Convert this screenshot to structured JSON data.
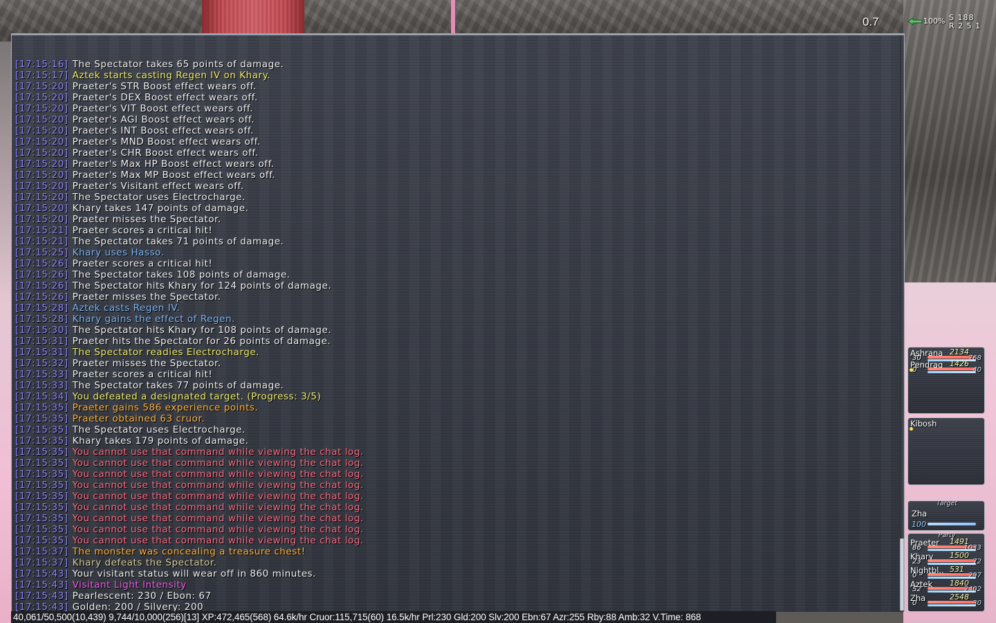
{
  "hud": {
    "fps": "0.7",
    "compass_pct": "100%",
    "compass_s": "S 188",
    "compass_r": "R 2 5 1"
  },
  "chat": {
    "lines": [
      {
        "ts": "[17:15:16]",
        "msg": "The Spectator takes 65 points of damage.",
        "color": "white"
      },
      {
        "ts": "[17:15:17]",
        "msg": "Aztek starts casting Regen IV on Khary.",
        "color": "yellow"
      },
      {
        "ts": "[17:15:20]",
        "msg": "Praeter's STR Boost effect wears off.",
        "color": "white"
      },
      {
        "ts": "[17:15:20]",
        "msg": "Praeter's DEX Boost effect wears off.",
        "color": "white"
      },
      {
        "ts": "[17:15:20]",
        "msg": "Praeter's VIT Boost effect wears off.",
        "color": "white"
      },
      {
        "ts": "[17:15:20]",
        "msg": "Praeter's AGI Boost effect wears off.",
        "color": "white"
      },
      {
        "ts": "[17:15:20]",
        "msg": "Praeter's INT Boost effect wears off.",
        "color": "white"
      },
      {
        "ts": "[17:15:20]",
        "msg": "Praeter's MND Boost effect wears off.",
        "color": "white"
      },
      {
        "ts": "[17:15:20]",
        "msg": "Praeter's CHR Boost effect wears off.",
        "color": "white"
      },
      {
        "ts": "[17:15:20]",
        "msg": "Praeter's Max HP Boost effect wears off.",
        "color": "white"
      },
      {
        "ts": "[17:15:20]",
        "msg": "Praeter's Max MP Boost effect wears off.",
        "color": "white"
      },
      {
        "ts": "[17:15:20]",
        "msg": "Praeter's Visitant effect wears off.",
        "color": "white"
      },
      {
        "ts": "[17:15:20]",
        "msg": "The Spectator uses Electrocharge.",
        "color": "white"
      },
      {
        "ts": "[17:15:20]",
        "msg": "Khary takes 147 points of damage.",
        "color": "white"
      },
      {
        "ts": "[17:15:20]",
        "msg": "Praeter misses the Spectator.",
        "color": "white"
      },
      {
        "ts": "[17:15:21]",
        "msg": "Praeter scores a critical hit!",
        "color": "white"
      },
      {
        "ts": "[17:15:21]",
        "msg": "The Spectator takes 71 points of damage.",
        "color": "white"
      },
      {
        "ts": "[17:15:25]",
        "msg": "Khary uses Hasso.",
        "color": "blue"
      },
      {
        "ts": "[17:15:26]",
        "msg": "Praeter scores a critical hit!",
        "color": "white"
      },
      {
        "ts": "[17:15:26]",
        "msg": "The Spectator takes 108 points of damage.",
        "color": "white"
      },
      {
        "ts": "[17:15:26]",
        "msg": "The Spectator hits Khary for 124 points of damage.",
        "color": "white"
      },
      {
        "ts": "[17:15:26]",
        "msg": "Praeter misses the Spectator.",
        "color": "white"
      },
      {
        "ts": "[17:15:28]",
        "msg": "Aztek casts Regen IV.",
        "color": "blue"
      },
      {
        "ts": "[17:15:28]",
        "msg": "Khary gains the effect of Regen.",
        "color": "blue"
      },
      {
        "ts": "[17:15:30]",
        "msg": "The Spectator hits Khary for 108 points of damage.",
        "color": "white"
      },
      {
        "ts": "[17:15:31]",
        "msg": "Praeter hits the Spectator for 26 points of damage.",
        "color": "white"
      },
      {
        "ts": "[17:15:31]",
        "msg": "The Spectator readies Electrocharge.",
        "color": "yellow"
      },
      {
        "ts": "[17:15:32]",
        "msg": "Praeter misses the Spectator.",
        "color": "white"
      },
      {
        "ts": "[17:15:33]",
        "msg": "Praeter scores a critical hit!",
        "color": "white"
      },
      {
        "ts": "[17:15:33]",
        "msg": "The Spectator takes 77 points of damage.",
        "color": "white"
      },
      {
        "ts": "[17:15:34]",
        "msg": "You defeated a designated target. (Progress: 3/5)",
        "color": "yellow"
      },
      {
        "ts": "[17:15:35]",
        "msg": "Praeter gains 586 experience points.",
        "color": "orange"
      },
      {
        "ts": "[17:15:35]",
        "msg": "Praeter obtained 63 cruor.",
        "color": "orange"
      },
      {
        "ts": "[17:15:35]",
        "msg": "The Spectator uses Electrocharge.",
        "color": "white"
      },
      {
        "ts": "[17:15:35]",
        "msg": "Khary takes 179 points of damage.",
        "color": "white"
      },
      {
        "ts": "[17:15:35]",
        "msg": "You cannot use that command while viewing the chat log.",
        "color": "red"
      },
      {
        "ts": "[17:15:35]",
        "msg": "You cannot use that command while viewing the chat log.",
        "color": "red"
      },
      {
        "ts": "[17:15:35]",
        "msg": "You cannot use that command while viewing the chat log.",
        "color": "red"
      },
      {
        "ts": "[17:15:35]",
        "msg": "You cannot use that command while viewing the chat log.",
        "color": "red"
      },
      {
        "ts": "[17:15:35]",
        "msg": "You cannot use that command while viewing the chat log.",
        "color": "red"
      },
      {
        "ts": "[17:15:35]",
        "msg": "You cannot use that command while viewing the chat log.",
        "color": "red"
      },
      {
        "ts": "[17:15:35]",
        "msg": "You cannot use that command while viewing the chat log.",
        "color": "red"
      },
      {
        "ts": "[17:15:35]",
        "msg": "You cannot use that command while viewing the chat log.",
        "color": "red"
      },
      {
        "ts": "[17:15:35]",
        "msg": "You cannot use that command while viewing the chat log.",
        "color": "red"
      },
      {
        "ts": "[17:15:37]",
        "msg": "The monster was concealing a treasure chest!",
        "color": "orange"
      },
      {
        "ts": "[17:15:37]",
        "msg": "Khary defeats the Spectator.",
        "color": "khaki"
      },
      {
        "ts": "[17:15:43]",
        "msg": "Your visitant status will wear off in 860 minutes.",
        "color": "white"
      },
      {
        "ts": "[17:15:43]",
        "msg": "Visitant Light Intensity",
        "color": "pink"
      },
      {
        "ts": "[17:15:43]",
        "msg": "Pearlescent: 230 / Ebon: 67",
        "color": "white"
      },
      {
        "ts": "[17:15:43]",
        "msg": "Golden: 200 / Silvery: 200",
        "color": "white"
      }
    ]
  },
  "statusbar": {
    "text": "40,061/50,500(10,439)  9,744/10,000(256)[13]  XP:472,465(568) 64.6k/hr Cruor:115,715(60) 16.5k/hr Prl:230 Gld:200 Slv:200 Ebn:67 Azr:255 Rby:88 Amb:32  V.Time: 868"
  },
  "alliance1": {
    "members": [
      {
        "name": "Ashrana",
        "hp": "2134",
        "tp": "30",
        "mp": "768",
        "hp_pct": 100,
        "mp_pct": 100
      },
      {
        "name": "Pendrag",
        "hp": "1426",
        "tp": "0",
        "mp": "40",
        "hp_pct": 100,
        "mp_pct": 100
      }
    ]
  },
  "alliance2": {
    "members": [
      {
        "name": "Kibosh"
      }
    ]
  },
  "target": {
    "header": "Target",
    "name": "Zha",
    "hp_pct_label": "100",
    "hp_pct": 100
  },
  "party": {
    "header": "Party",
    "members": [
      {
        "name": "Praeter",
        "hp": "1491",
        "tp": "86",
        "mp": "1033",
        "hp_pct": 100,
        "mp_pct": 100
      },
      {
        "name": "Khary",
        "hp": "1500",
        "tp": "23",
        "mp": "72",
        "hp_pct": 100,
        "mp_pct": 100
      },
      {
        "name": "Nightbl..",
        "hp": "531",
        "tp": "0",
        "mp": "297",
        "hp_pct": 100,
        "mp_pct": 100
      },
      {
        "name": "Aztek",
        "hp": "1840",
        "tp": "52",
        "mp": "2402",
        "hp_pct": 100,
        "mp_pct": 100
      },
      {
        "name": "Zha",
        "hp": "2548",
        "tp": "0",
        "mp": "30",
        "hp_pct": 100,
        "mp_pct": 100
      }
    ]
  },
  "colors": {
    "timestamp": "#8c84f6",
    "white": "#f2f2f2",
    "yellow": "#f1ee6e",
    "blue": "#7fb7f5",
    "orange": "#ffb43c",
    "red": "#ff6a82",
    "pink": "#f25de8",
    "khaki": "#d8cf96"
  }
}
